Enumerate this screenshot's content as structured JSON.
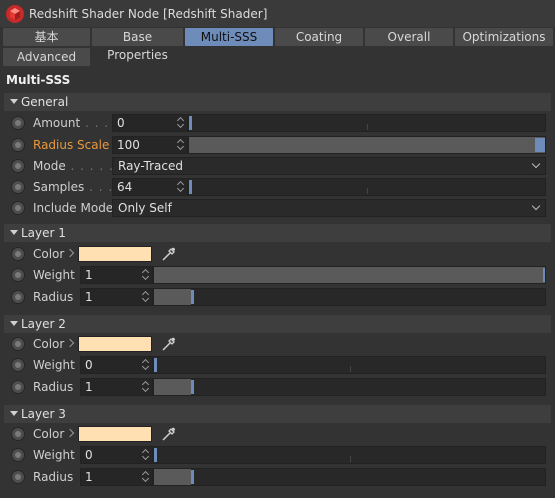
{
  "window": {
    "title": "Redshift Shader Node [Redshift Shader]",
    "logo": "redshift-cube-logo"
  },
  "tabs": [
    {
      "label": "基本",
      "active": false
    },
    {
      "label": "Base Properties",
      "active": false
    },
    {
      "label": "Multi-SSS",
      "active": true
    },
    {
      "label": "Coating",
      "active": false
    },
    {
      "label": "Overall",
      "active": false
    },
    {
      "label": "Optimizations",
      "active": false
    },
    {
      "label": "Advanced",
      "active": false
    }
  ],
  "section": {
    "title": "Multi-SSS"
  },
  "general": {
    "header": "General",
    "amount": {
      "label": "Amount",
      "value": "0",
      "slider": 0.0
    },
    "radius_scale": {
      "label": "Radius Scale",
      "value": "100",
      "slider": 1.0
    },
    "mode": {
      "label": "Mode",
      "value": "Ray-Traced"
    },
    "samples": {
      "label": "Samples",
      "value": "64",
      "slider": 0.0
    },
    "include_mode": {
      "label": "Include Mode",
      "value": "Only Self"
    }
  },
  "layers": [
    {
      "header": "Layer 1",
      "color_label": "Color",
      "color": "#ffe0b3",
      "weight_label": "Weight",
      "weight": "1",
      "weight_slider": 1.0,
      "radius_label": "Radius",
      "radius": "1",
      "radius_slider": 0.1
    },
    {
      "header": "Layer 2",
      "color_label": "Color",
      "color": "#ffe0b3",
      "weight_label": "Weight",
      "weight": "0",
      "weight_slider": 0.0,
      "radius_label": "Radius",
      "radius": "1",
      "radius_slider": 0.1
    },
    {
      "header": "Layer 3",
      "color_label": "Color",
      "color": "#ffe0b3",
      "weight_label": "Weight",
      "weight": "0",
      "weight_slider": 0.0,
      "radius_label": "Radius",
      "radius": "1",
      "radius_slider": 0.1
    }
  ],
  "colors": {
    "accent": "#6d8cb9",
    "highlight_label": "#e8983e"
  }
}
